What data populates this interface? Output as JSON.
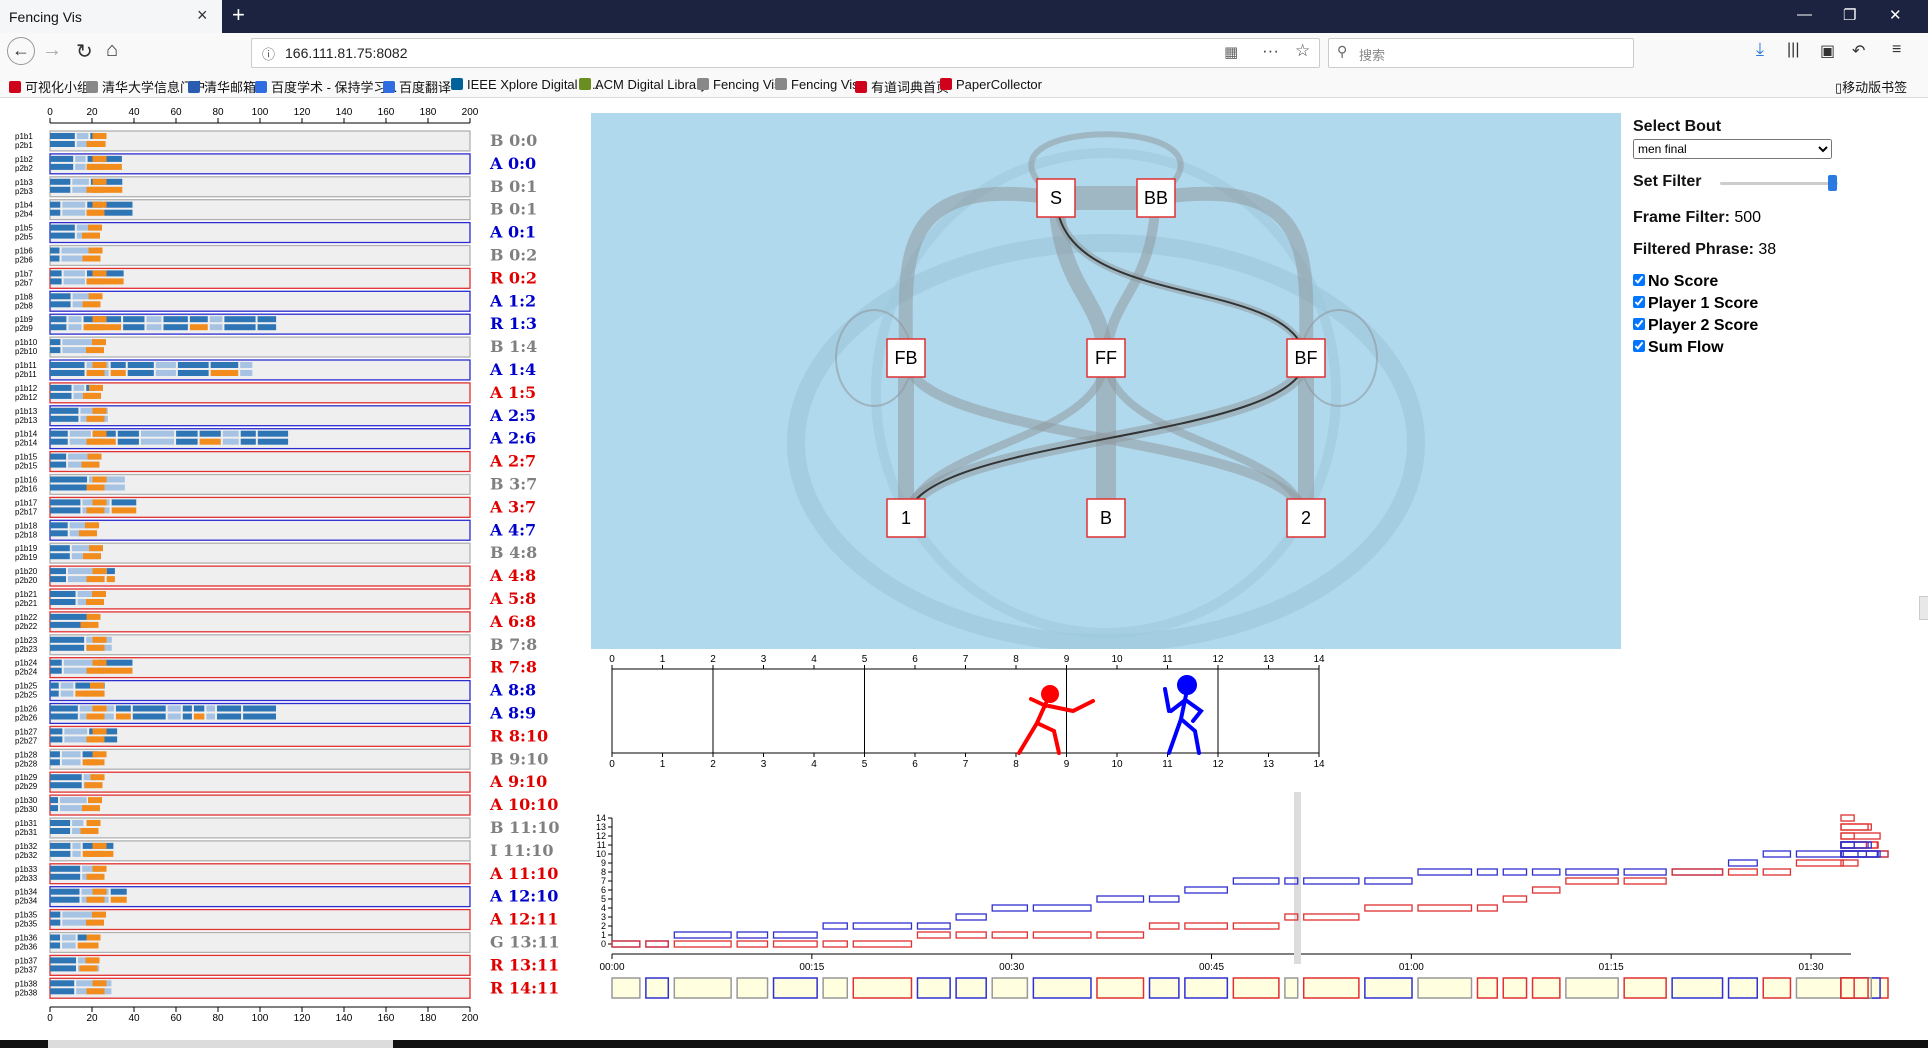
{
  "browser": {
    "tab_title": "Fencing Vis",
    "url": "166.111.81.75:8082",
    "search_placeholder": "搜索",
    "bookmarks": [
      {
        "label": "可视化小组",
        "icon": "red-arc-icon",
        "color": "#d0021b"
      },
      {
        "label": "清华大学信息门户",
        "icon": "globe-icon",
        "color": "#888888"
      },
      {
        "label": "清华邮箱",
        "icon": "c-logo-icon",
        "color": "#2a5db0"
      },
      {
        "label": "百度学术 - 保持学习...",
        "icon": "paw-icon",
        "color": "#2f6de1"
      },
      {
        "label": "百度翻译",
        "icon": "translate-icon",
        "color": "#2f6de1"
      },
      {
        "label": "IEEE Xplore Digital L...",
        "icon": "ieee-icon",
        "color": "#00629b"
      },
      {
        "label": "ACM Digital Library",
        "icon": "acm-icon",
        "color": "#6b8e23"
      },
      {
        "label": "Fencing Vis",
        "icon": "globe-icon",
        "color": "#888888"
      },
      {
        "label": "Fencing Vis",
        "icon": "globe-icon",
        "color": "#888888"
      },
      {
        "label": "有道词典首页",
        "icon": "youdao-icon",
        "color": "#d0021b"
      },
      {
        "label": "PaperCollector",
        "icon": "p-logo-icon",
        "color": "#d0021b"
      }
    ],
    "mobile_bookmarks": "移动版书签"
  },
  "controls": {
    "select_bout_label": "Select Bout",
    "bout_value": "men final",
    "set_filter_label": "Set Filter",
    "slider_fraction": 0.95,
    "frame_filter_label": "Frame Filter:",
    "frame_filter_value": "500",
    "filtered_phrase_label": "Filtered Phrase:",
    "filtered_phrase_value": "38",
    "checkboxes": [
      {
        "label": "No Score",
        "checked": true
      },
      {
        "label": "Player 1 Score",
        "checked": true
      },
      {
        "label": "Player 2 Score",
        "checked": true
      },
      {
        "label": "Sum Flow",
        "checked": true
      }
    ]
  },
  "flow_graph": {
    "nodes": [
      "S",
      "BB",
      "FB",
      "FF",
      "BF",
      "1",
      "B",
      "2"
    ]
  },
  "piste": {
    "ticks": [
      "0",
      "1",
      "2",
      "3",
      "4",
      "5",
      "6",
      "7",
      "8",
      "9",
      "10",
      "11",
      "12",
      "13",
      "14"
    ],
    "fencer_left_color": "#ff0000",
    "fencer_right_color": "#0000ff"
  },
  "score_chart": {
    "y_ticks": [
      "0",
      "1",
      "2",
      "3",
      "4",
      "5",
      "6",
      "7",
      "8",
      "9",
      "10",
      "11",
      "12",
      "13",
      "14"
    ],
    "time_ticks": [
      "00:00",
      "00:15",
      "00:30",
      "00:45",
      "01:00",
      "01:15",
      "01:30"
    ]
  },
  "phrases": {
    "axis_ticks": [
      "0",
      "20",
      "40",
      "60",
      "80",
      "100",
      "120",
      "140",
      "160",
      "180",
      "200"
    ],
    "rows": [
      {
        "result": "B",
        "score": "0:0",
        "color": "gray"
      },
      {
        "result": "A",
        "score": "0:0",
        "color": "blue"
      },
      {
        "result": "B",
        "score": "0:1",
        "color": "gray"
      },
      {
        "result": "B",
        "score": "0:1",
        "color": "gray"
      },
      {
        "result": "A",
        "score": "0:1",
        "color": "blue"
      },
      {
        "result": "B",
        "score": "0:2",
        "color": "gray"
      },
      {
        "result": "R",
        "score": "0:2",
        "color": "red"
      },
      {
        "result": "A",
        "score": "1:2",
        "color": "blue"
      },
      {
        "result": "R",
        "score": "1:3",
        "color": "blue"
      },
      {
        "result": "B",
        "score": "1:4",
        "color": "gray"
      },
      {
        "result": "A",
        "score": "1:4",
        "color": "blue"
      },
      {
        "result": "A",
        "score": "1:5",
        "color": "red"
      },
      {
        "result": "A",
        "score": "2:5",
        "color": "blue"
      },
      {
        "result": "A",
        "score": "2:6",
        "color": "blue"
      },
      {
        "result": "A",
        "score": "2:7",
        "color": "red"
      },
      {
        "result": "B",
        "score": "3:7",
        "color": "gray"
      },
      {
        "result": "A",
        "score": "3:7",
        "color": "red"
      },
      {
        "result": "A",
        "score": "4:7",
        "color": "blue"
      },
      {
        "result": "B",
        "score": "4:8",
        "color": "gray"
      },
      {
        "result": "A",
        "score": "4:8",
        "color": "red"
      },
      {
        "result": "A",
        "score": "5:8",
        "color": "red"
      },
      {
        "result": "A",
        "score": "6:8",
        "color": "red"
      },
      {
        "result": "B",
        "score": "7:8",
        "color": "gray"
      },
      {
        "result": "R",
        "score": "7:8",
        "color": "red"
      },
      {
        "result": "A",
        "score": "8:8",
        "color": "blue"
      },
      {
        "result": "A",
        "score": "8:9",
        "color": "blue"
      },
      {
        "result": "R",
        "score": "8:10",
        "color": "red"
      },
      {
        "result": "B",
        "score": "9:10",
        "color": "gray"
      },
      {
        "result": "A",
        "score": "9:10",
        "color": "red"
      },
      {
        "result": "A",
        "score": "10:10",
        "color": "red"
      },
      {
        "result": "B",
        "score": "11:10",
        "color": "gray"
      },
      {
        "result": "I",
        "score": "11:10",
        "color": "gray"
      },
      {
        "result": "A",
        "score": "11:10",
        "color": "red"
      },
      {
        "result": "A",
        "score": "12:10",
        "color": "blue"
      },
      {
        "result": "A",
        "score": "12:11",
        "color": "red"
      },
      {
        "result": "G",
        "score": "13:11",
        "color": "gray"
      },
      {
        "result": "R",
        "score": "13:11",
        "color": "red"
      },
      {
        "result": "R",
        "score": "14:11",
        "color": "red"
      }
    ]
  }
}
